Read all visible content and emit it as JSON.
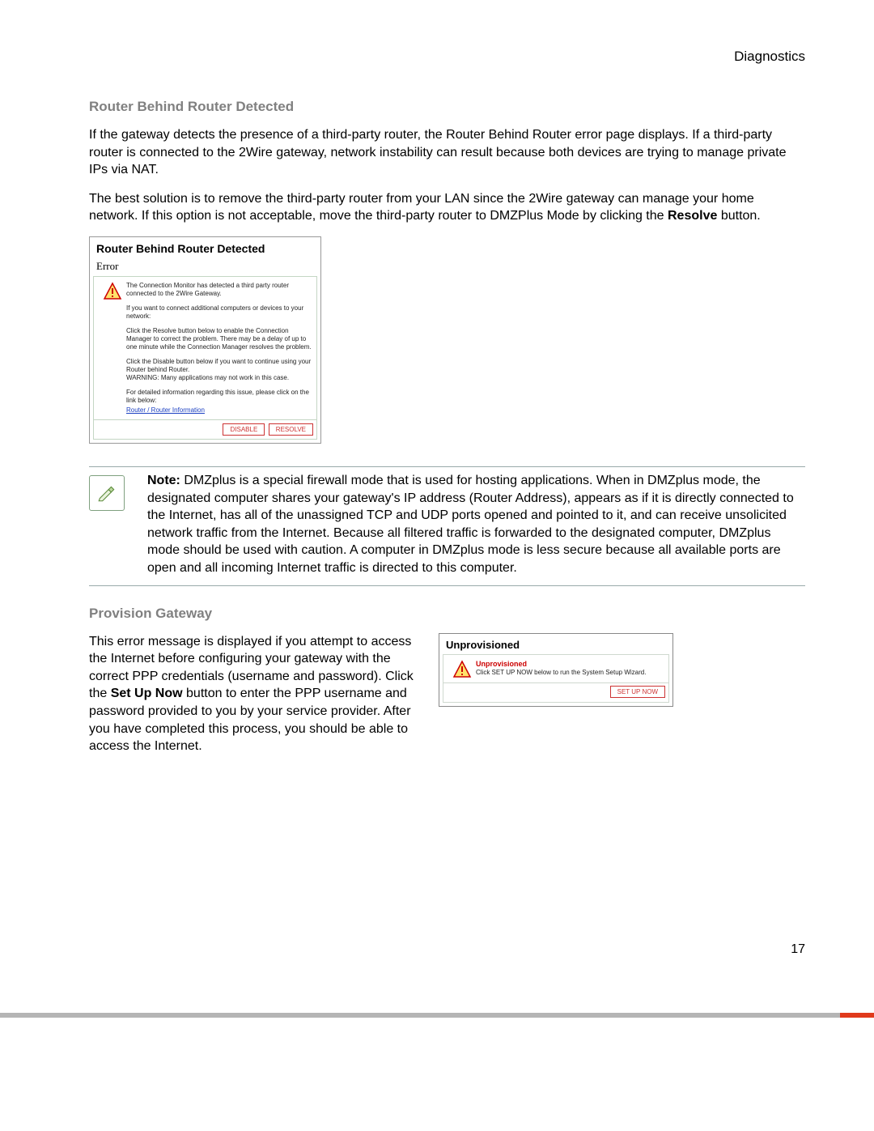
{
  "header": {
    "section": "Diagnostics"
  },
  "router": {
    "heading": "Router Behind Router Detected",
    "p1": "If the gateway detects the presence of a third-party router, the Router Behind Router error page displays. If a third-party router is connected to the 2Wire gateway, network instability can result because both devices are trying to manage private IPs via NAT.",
    "p2_a": "The best solution is to remove the third-party router from your LAN since the 2Wire gateway can manage your home network. If this option is not acceptable, move the third-party router to DMZPlus Mode by clicking the ",
    "p2_bold": "Resolve",
    "p2_b": " button.",
    "panel": {
      "title": "Router Behind Router Detected",
      "subtitle": "Error",
      "msg1": "The Connection Monitor has detected a third party router connected to the 2Wire Gateway.",
      "msg2": "If you want to connect additional computers or devices to your network:",
      "msg3": "Click the Resolve button below to enable the Connection Manager to correct the problem. There may be a delay of up to one minute while the Connection Manager resolves the problem.",
      "msg4": "Click the Disable button below if you want to continue using your Router behind Router.\nWARNING: Many applications may not work in this case.",
      "msg5": "For detailed information regarding this issue, please click on the link below:",
      "link": "Router / Router Information",
      "btn_disable": "DISABLE",
      "btn_resolve": "RESOLVE"
    }
  },
  "note": {
    "label": "Note:",
    "text": " DMZplus is a special firewall mode that is used for hosting applications. When in DMZplus mode, the designated computer shares your gateway's IP address (Router Address), appears as if it is directly connected to the Internet, has all of the unassigned TCP and UDP ports opened and pointed to it, and can receive unsolicited network traffic from the Internet. Because all filtered traffic is forwarded to the designated computer, DMZplus mode should be used with caution. A computer in DMZplus mode is less secure because all available ports are open and all incoming Internet traffic is directed to this computer."
  },
  "provision": {
    "heading": "Provision Gateway",
    "p_a": "This error message is displayed if you attempt to access the Internet before configuring your gateway with the correct PPP credentials (username and password). Click the ",
    "p_bold": "Set Up Now",
    "p_b": " button to enter the PPP username and password provided to you by your service provider. After you have completed this process, you should be able to access the Internet.",
    "panel": {
      "title": "Unprovisioned",
      "status": "Unprovisioned",
      "msg": "Click SET UP NOW below to run the System Setup Wizard.",
      "btn": "SET UP NOW"
    }
  },
  "page_number": "17"
}
